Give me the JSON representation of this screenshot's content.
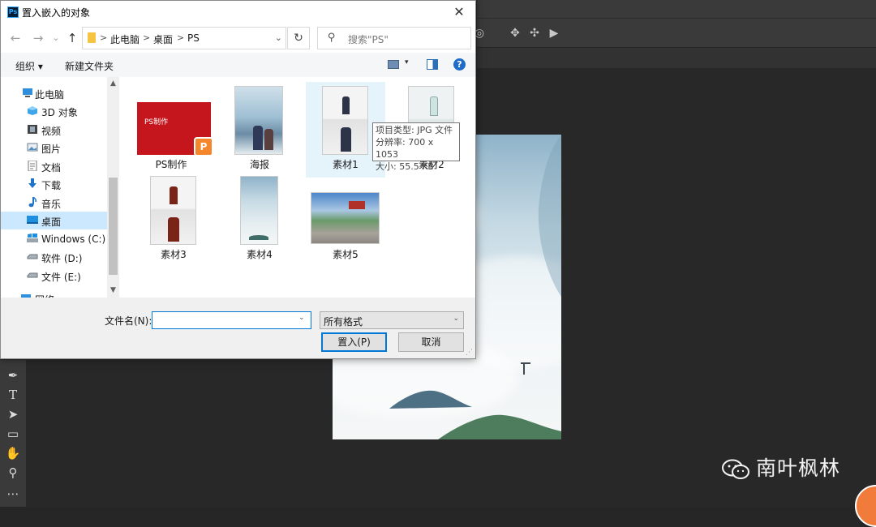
{
  "dialog": {
    "title": "置入嵌入的对象",
    "app_logo": "Ps",
    "close_icon": "✕"
  },
  "nav": {
    "back_icon": "←",
    "forward_icon": "→",
    "recent_icon": "⌄",
    "up_icon": "↑",
    "breadcrumbs": [
      "此电脑",
      "桌面",
      "PS"
    ],
    "crumb_separator": ">",
    "refresh_icon": "↻",
    "search_placeholder": "搜索\"PS\""
  },
  "commandbar": {
    "organize": "组织 ▾",
    "new_folder": "新建文件夹",
    "help": "?"
  },
  "sidebar": {
    "items": [
      {
        "label": "此电脑",
        "icon": "pc-icon"
      },
      {
        "label": "3D 对象",
        "icon": "3d-objects-icon"
      },
      {
        "label": "视频",
        "icon": "video-icon"
      },
      {
        "label": "图片",
        "icon": "pictures-icon"
      },
      {
        "label": "文档",
        "icon": "documents-icon"
      },
      {
        "label": "下载",
        "icon": "downloads-icon"
      },
      {
        "label": "音乐",
        "icon": "music-icon"
      },
      {
        "label": "桌面",
        "icon": "desktop-icon",
        "selected": true
      },
      {
        "label": "Windows (C:)",
        "icon": "drive-c-icon"
      },
      {
        "label": "软件 (D:)",
        "icon": "drive-d-icon"
      },
      {
        "label": "文件 (E:)",
        "icon": "drive-e-icon"
      },
      {
        "label": "网络",
        "icon": "network-icon"
      }
    ]
  },
  "files": [
    {
      "name": "PS制作",
      "type": "pptx",
      "thumb_text": "PS制作"
    },
    {
      "name": "海报",
      "type": "image"
    },
    {
      "name": "素材1",
      "type": "image",
      "hovered": true
    },
    {
      "name": "素材2",
      "type": "image"
    },
    {
      "name": "素材3",
      "type": "image"
    },
    {
      "name": "素材4",
      "type": "image"
    },
    {
      "name": "素材5",
      "type": "image"
    }
  ],
  "tooltip": {
    "line1": "项目类型: JPG 文件",
    "line2": "分辨率: 700 x 1053",
    "line3": "大小: 55.5 KB"
  },
  "bottom": {
    "filename_label": "文件名(N):",
    "filename_value": "",
    "format_value": "所有格式",
    "place_button": "置入(P)",
    "cancel_button": "取消"
  },
  "watermark": {
    "text": "南叶枫林"
  },
  "colors": {
    "selection": "#cce8ff",
    "hover": "#e5f3fb",
    "accent": "#0078d7",
    "ps_panel": "#3a3a3a"
  }
}
